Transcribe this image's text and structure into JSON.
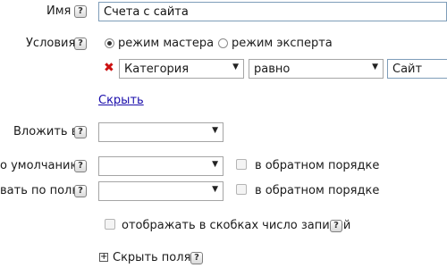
{
  "name_row": {
    "label": "Имя",
    "value": "Счета с сайта"
  },
  "conditions_row": {
    "label": "Условия",
    "modes": [
      {
        "label": "режим мастера",
        "checked": true
      },
      {
        "label": "режим эксперта",
        "checked": false
      }
    ],
    "condition": {
      "field": "Категория",
      "operator": "равно",
      "value": "Сайт"
    },
    "hide_link": "Скрыть"
  },
  "nest_row": {
    "label": "Вложить в",
    "value": ""
  },
  "default_row": {
    "label": "о умолчанию",
    "value": "",
    "reverse_label": "в обратном порядке",
    "reverse_checked": false
  },
  "by_field_row": {
    "label": "вать по полю",
    "value": "",
    "reverse_label": "в обратном порядке",
    "reverse_checked": false
  },
  "show_count": {
    "label": "отображать в скобках число записей",
    "checked": false
  },
  "hide_fields": {
    "label": "Скрыть поля"
  },
  "icons": {
    "help": "?",
    "remove": "✖",
    "dropdown": "▼",
    "expand": "+"
  },
  "colors": {
    "remove_icon": "#cc1111",
    "link": "#1a0dab",
    "input_border": "#7e9db9"
  }
}
